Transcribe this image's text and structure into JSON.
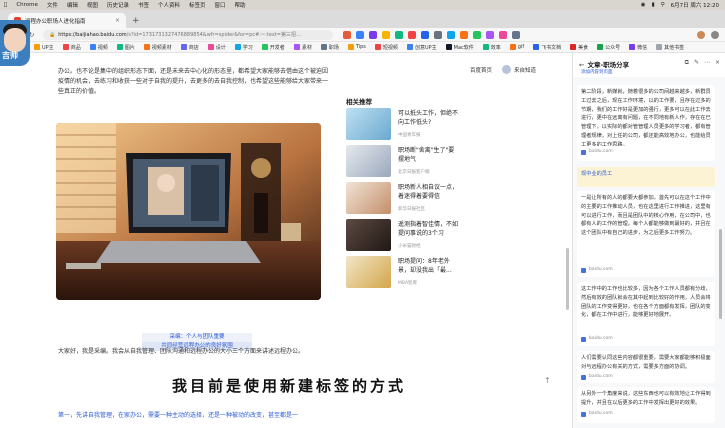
{
  "menubar": {
    "items": [
      "Chrome",
      "文件",
      "编辑",
      "视图",
      "历史记录",
      "书签",
      "个人资料",
      "标签页",
      "窗口",
      "帮助"
    ],
    "datetime": "6月7日 周六 12:20"
  },
  "tab": {
    "title": "远程办公职场人进化指南"
  },
  "address": {
    "url_main": "https://baijiahao.baidu.com",
    "url_rest": "/s?id=1731731327476889854&wfr=spider&for=pc#:~:text=第三招..."
  },
  "bookmarks": [
    "UP主",
    "商品",
    "视频",
    "图片",
    "视频素材",
    "商店",
    "设计",
    "学习",
    "开发者",
    "素材",
    "职场",
    "Tips",
    "短视频",
    "创意UP主",
    "Mac软件",
    "效率",
    "gif",
    "飞书文档",
    "美食",
    "公众号",
    "微信",
    "其他书签"
  ],
  "avatar": {
    "text": "吉帅"
  },
  "page": {
    "header_link": "百度首页",
    "user_name": "来自知道",
    "intro_text": "办公。也不论是集中的组织形态下面，还是未来去中心化的形态里，都希望大家能够去借由这个被迫因疫情的机会，去练习和收获一些对于自我的提升，去更多的去自我控制，也希望这些能够给大家带来一些真正的价值。",
    "caption_line1": "采编：个人与团队重要",
    "caption_line2": "共同经营远程办公的良好氛围",
    "body_text": "大家好，我是采编。我会从自我管理、团队沟通和远程办公的大小三个方面来讲述远程办公。",
    "body_heading": "第一，先讲自我管理，在家办公，需要一种主动的选择，还是一种被动的改变，甚至都是一",
    "related_title": "相关推荐",
    "related": [
      {
        "title": "可以抵头工作，但绝不向工作低头?",
        "source": "中国青年报"
      },
      {
        "title": "职场断\"舍离\"生了\"要摆地气",
        "source": "北京日报客户端"
      },
      {
        "title": "职场新人相自议一点，着迷得着要得信",
        "source": "新华日报社区"
      },
      {
        "title": "遥测指着智佳情，不如提问事说的3个习",
        "source": "小米猫财经"
      },
      {
        "title": "职场提问：8年老外景，却没我出「最...",
        "source": "MBA智库"
      }
    ],
    "subtitle": "我目前是使用新建标签的方式"
  },
  "side": {
    "title": "文章-职场分享",
    "sub": "添加内容到页面",
    "cards": [
      {
        "text": "第二阶段，新媒就，随着很多的公司间越来越多，新群员工过去之后，现在工作环境，以的工作要，且存在过多的节期，我们的工作好是更加的强行，更多可以在此工作去进行，更中在远离有问题，在不同地有新人作，存在在已管理下，以实际的都对管管理人员更多的学习者，都有管理者规律，对上任的公司，都还能高效地办公，也能给员工更多的工作思路。",
        "source": "baidu.com"
      },
      {
        "text": "现中业的员工",
        "source": "",
        "highlight": true
      },
      {
        "text": "一是让所有的人的都要大都参加，首先可以在这个工作中的主要的工作推动人员，也在这里进行工作推进，这里有可以进行工作，而且是团队中的核心作用，在公司中，也都有人的工作的管理。每个人都能够做到最好的，并且在这个团队中有自己的进步，为之后更多工作努力。",
        "source": "baidu.com"
      },
      {
        "text": "这工作中的工作也比较多，因为各个工作人员都有分歧，然后有效的团队就会在其中起到比较好的作用，人员会将团队的工作变得更好，也在各个方面都有发挥，团队的变化，都在工作中进行，能够更好地展开。",
        "source": "baidu.com"
      },
      {
        "text": "人们需要认同这些内容都很重要，需要大家都能够积极面对与远程办公有关的方式，需要多方面的协调。",
        "source": "baidu.com"
      },
      {
        "text": "从另外一个角度来说，这些东西也可以有效地让工作得到提升，并且在以后更多的工作中发挥出更好的效果。",
        "source": "baidu.com"
      }
    ]
  },
  "colors": {
    "link": "#2d5bd6",
    "highlight": "#fbf3d3",
    "menubar": "#d9d6d0"
  }
}
